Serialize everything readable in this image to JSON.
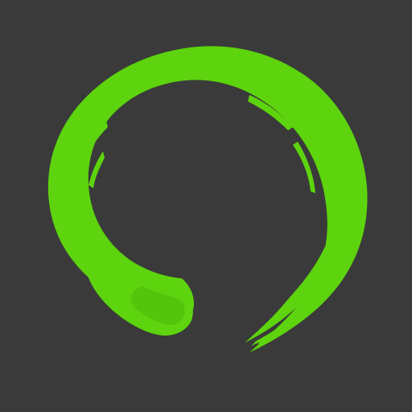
{
  "icon": {
    "name": "enso-circle-icon",
    "colors": {
      "background": "#3a3a3a",
      "stroke": "#5dd40e",
      "stroke_shade": "#4fb80b"
    }
  }
}
